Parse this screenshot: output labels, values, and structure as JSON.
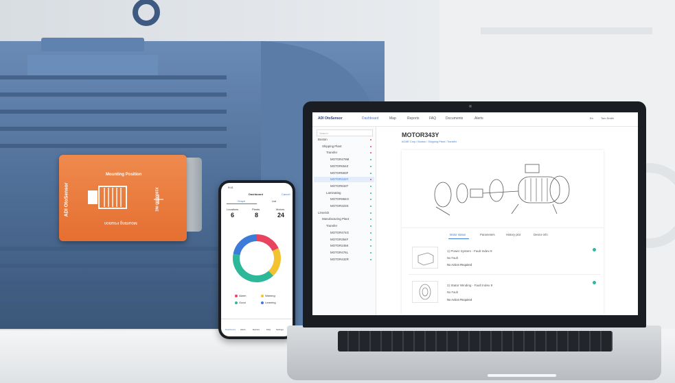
{
  "sensor": {
    "brand": "ADI OtoSensor",
    "title": "Mounting Position",
    "title_flipped": "Mounting Position",
    "serial": "X10000000 INE"
  },
  "phone": {
    "time": "9:41",
    "title": "Dashboard",
    "tabs": [
      "Graph",
      "List"
    ],
    "cancel": "Cancel",
    "stats": [
      {
        "label": "Locations",
        "value": "6"
      },
      {
        "label": "Plants",
        "value": "8"
      },
      {
        "label": "Motors",
        "value": "24"
      }
    ],
    "donut": [
      {
        "label": "Alarm",
        "color": "#e8445f",
        "share": 0.18
      },
      {
        "label": "Warning",
        "color": "#f2c230",
        "share": 0.2
      },
      {
        "label": "Good",
        "color": "#2db89a",
        "share": 0.4
      },
      {
        "label": "Learning",
        "color": "#3d7bd8",
        "share": 0.22
      }
    ],
    "bottom_nav": [
      "Dashboard",
      "Alerts",
      "Explore",
      "FAQ",
      "Settings"
    ]
  },
  "laptop": {
    "brand": "ADI OtoSensor",
    "nav": [
      "Dashboard",
      "Map",
      "Reports",
      "FAQ",
      "Documents",
      "Alerts"
    ],
    "lang": "En",
    "user": "Tom Smith",
    "search_placeholder": "Search",
    "tree": [
      {
        "label": "Boston",
        "level": 0,
        "status": "alarm"
      },
      {
        "label": "Shipping Plant",
        "level": 1,
        "status": "alarm"
      },
      {
        "label": "Transfer",
        "level": 2,
        "status": "alarm"
      },
      {
        "label": "MOTOR479M",
        "level": 3,
        "status": "good"
      },
      {
        "label": "MOTOR654Z",
        "level": 3,
        "status": "good"
      },
      {
        "label": "MOTOR593F",
        "level": 3,
        "status": "good"
      },
      {
        "label": "MOTOR343Y",
        "level": 3,
        "status": "alarm",
        "selected": true
      },
      {
        "label": "MOTOR533T",
        "level": 3,
        "status": "good"
      },
      {
        "label": "Laminating",
        "level": 2,
        "status": "good"
      },
      {
        "label": "MOTOR984O",
        "level": 3,
        "status": "good"
      },
      {
        "label": "MOTOR323S",
        "level": 3,
        "status": "good"
      },
      {
        "label": "Limerick",
        "level": 0,
        "status": "good"
      },
      {
        "label": "Manufacturing Plant",
        "level": 1,
        "status": "good"
      },
      {
        "label": "Transfer",
        "level": 2,
        "status": "good"
      },
      {
        "label": "MOTOR474G",
        "level": 3,
        "status": "good"
      },
      {
        "label": "MOTOR394F",
        "level": 3,
        "status": "good"
      },
      {
        "label": "MOTOR245K",
        "level": 3,
        "status": "good"
      },
      {
        "label": "MOTOR476L",
        "level": 3,
        "status": "good"
      },
      {
        "label": "MOTOR432R",
        "level": 3,
        "status": "good"
      }
    ],
    "motor_title": "MOTOR343Y",
    "breadcrumb": "ACME Corp / Boston / Shipping Plant / Transfer",
    "tabs": [
      "Motor status",
      "Parameters",
      "History plot",
      "Device info"
    ],
    "faults": [
      {
        "title": "1) Power System - Fault Index 9",
        "status": "No Fault",
        "action": "No Action Required"
      },
      {
        "title": "2) Stator Winding - Fault Index 9",
        "status": "No Fault",
        "action": "No Action Required"
      }
    ]
  },
  "colors": {
    "motor_blue": "#4f6f98",
    "sensor_orange": "#e8773a",
    "alarm": "#e8445f",
    "good": "#2db89a",
    "accent": "#3d7bd8"
  }
}
